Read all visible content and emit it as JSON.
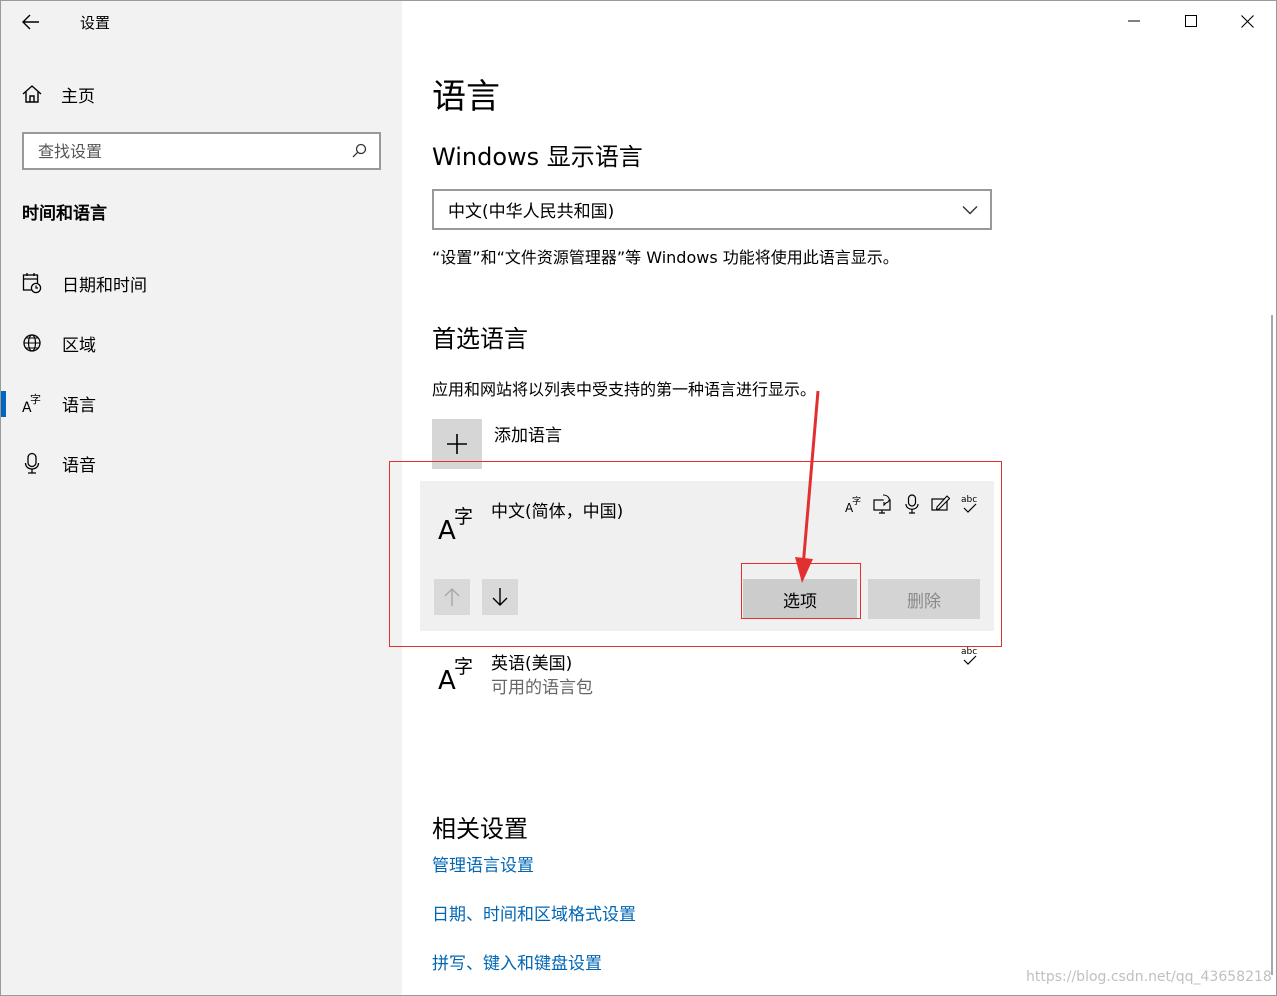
{
  "window": {
    "title": "设置"
  },
  "sidebar": {
    "home_label": "主页",
    "search_placeholder": "查找设置",
    "section_title": "时间和语言",
    "items": [
      {
        "label": "日期和时间",
        "icon": "calendar-clock-icon",
        "active": false
      },
      {
        "label": "区域",
        "icon": "globe-icon",
        "active": false
      },
      {
        "label": "语言",
        "icon": "language-icon",
        "active": true
      },
      {
        "label": "语音",
        "icon": "microphone-icon",
        "active": false
      }
    ]
  },
  "content": {
    "title": "语言",
    "display_language": {
      "heading": "Windows 显示语言",
      "selected": "中文(中华人民共和国)",
      "note": "“设置”和“文件资源管理器”等 Windows 功能将使用此语言显示。"
    },
    "preferred": {
      "heading": "首选语言",
      "description": "应用和网站将以列表中受支持的第一种语言进行显示。",
      "add_label": "添加语言",
      "languages": [
        {
          "name": "中文(简体，中国)",
          "options_label": "选项",
          "remove_label": "删除"
        },
        {
          "name": "英语(美国)",
          "status": "可用的语言包"
        }
      ]
    },
    "related": {
      "heading": "相关设置",
      "links": [
        "管理语言设置",
        "日期、时间和区域格式设置",
        "拼写、键入和键盘设置"
      ]
    }
  },
  "watermark": "https://blog.csdn.net/qq_43658218",
  "colors": {
    "accent": "#0067c0",
    "link": "#0066b4",
    "annotation": "#e23030"
  }
}
